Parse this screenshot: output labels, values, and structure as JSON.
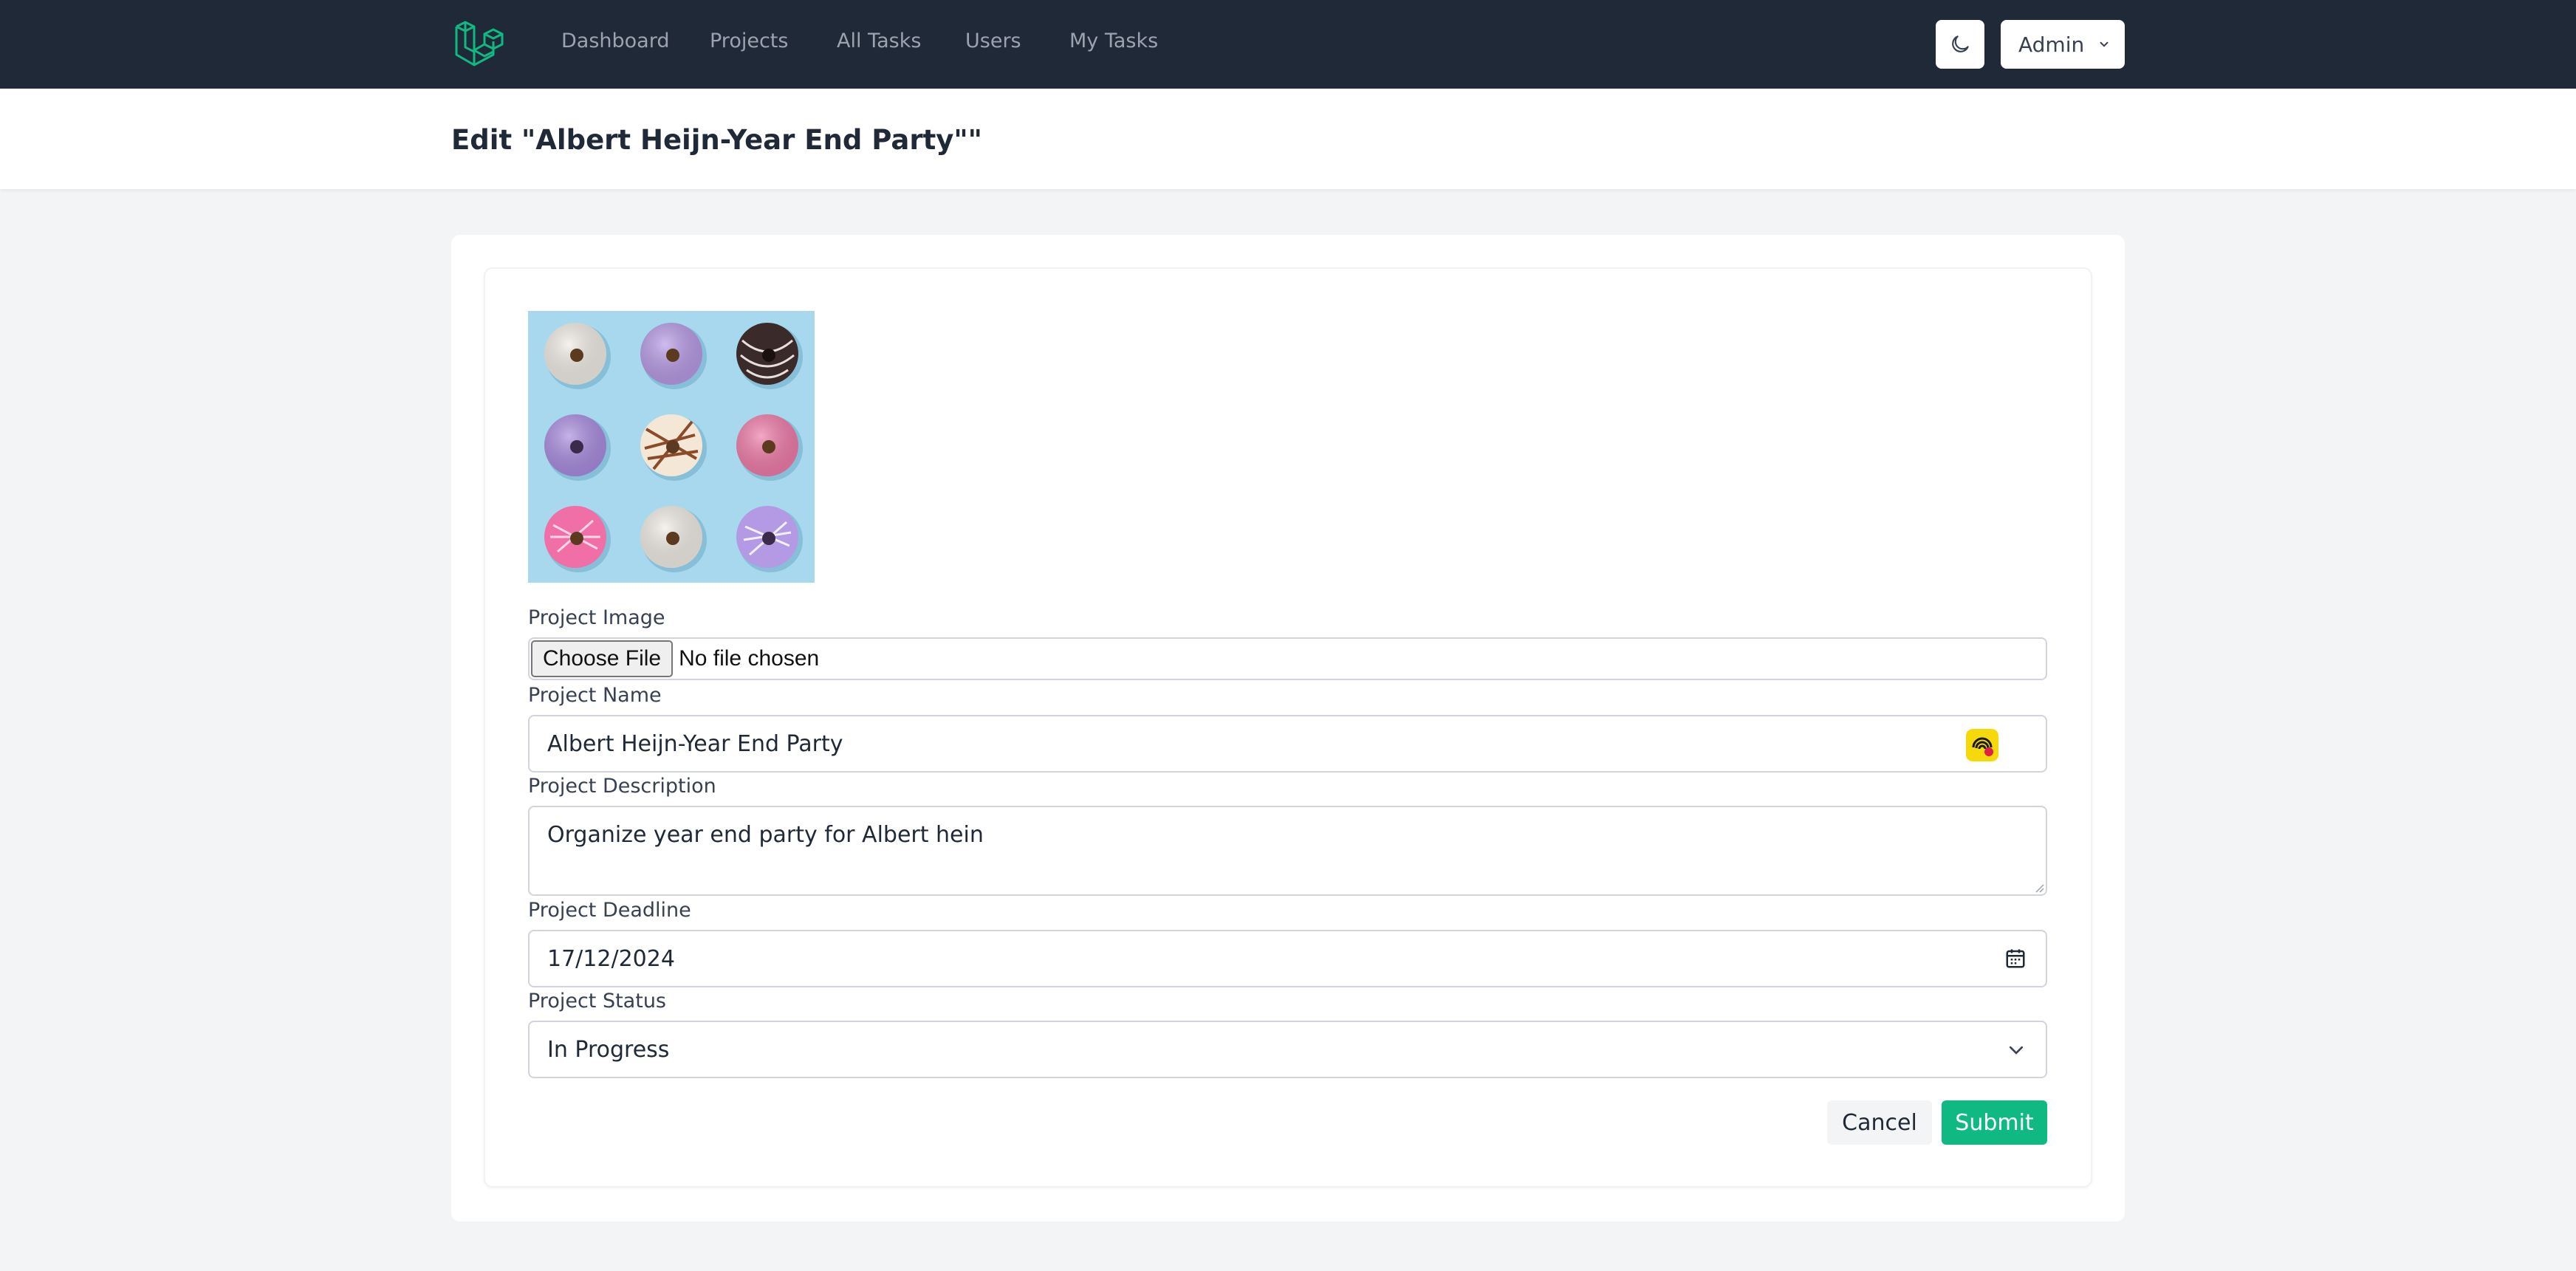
{
  "nav": {
    "links": [
      "Dashboard",
      "Projects",
      "All Tasks",
      "Users",
      "My Tasks"
    ],
    "theme_icon": "moon-icon",
    "user_menu_label": "Admin"
  },
  "header": {
    "title": "Edit \"Albert Heijn-Year End Party\"\""
  },
  "form": {
    "image_label": "Project Image",
    "file_button": "Choose File",
    "file_status": "No file chosen",
    "name_label": "Project Name",
    "name_value": "Albert Heijn-Year End Party",
    "description_label": "Project Description",
    "description_value": "Organize year end party for Albert hein",
    "deadline_label": "Project Deadline",
    "deadline_value": "17/12/2024",
    "status_label": "Project Status",
    "status_value": "In Progress",
    "cancel_label": "Cancel",
    "submit_label": "Submit"
  },
  "colors": {
    "nav_bg": "#1f2937",
    "accent": "#10b981",
    "image_bg": "#a8d8ee"
  }
}
